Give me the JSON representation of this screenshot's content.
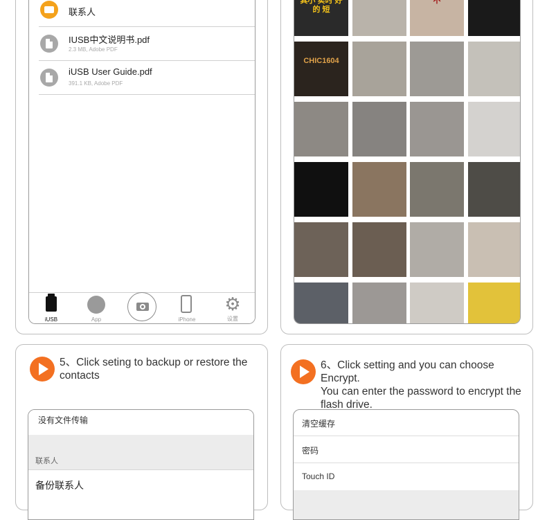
{
  "file_list": [
    {
      "name": "联系人",
      "meta": "",
      "type": "folder"
    },
    {
      "name": "IUSB中文说明书.pdf",
      "meta": "2.3 MB, Adobe PDF",
      "type": "pdf"
    },
    {
      "name": "iUSB User Guide.pdf",
      "meta": "391.1 KB, Adobe PDF",
      "type": "pdf"
    }
  ],
  "tabbar": {
    "iusb": "iUSB",
    "app": "App",
    "iphone": "iPhone",
    "settings": "设置"
  },
  "photo_grid": {
    "rows": 6,
    "cols": 4,
    "tiles": [
      {
        "bg": "#2a2a2a",
        "text": "其小 实时 好的 短",
        "color": "#f5c31a"
      },
      {
        "bg": "#b9b3aa",
        "text": "",
        "color": "#000"
      },
      {
        "bg": "#c7b4a3",
        "text": "不",
        "color": "#a01010"
      },
      {
        "bg": "#1a1a1a",
        "text": "",
        "color": "#e33"
      },
      {
        "bg": "#2b241e",
        "text": "CHIC1604",
        "color": "#e0a24a"
      },
      {
        "bg": "#a8a39a",
        "text": "",
        "color": "#000"
      },
      {
        "bg": "#9d9a95",
        "text": "",
        "color": "#000"
      },
      {
        "bg": "#c4c1ba",
        "text": "",
        "color": "#000"
      },
      {
        "bg": "#8d8984",
        "text": "",
        "color": "#000"
      },
      {
        "bg": "#868380",
        "text": "",
        "color": "#000"
      },
      {
        "bg": "#9a9692",
        "text": "",
        "color": "#000"
      },
      {
        "bg": "#d4d2cf",
        "text": "",
        "color": "#000"
      },
      {
        "bg": "#101010",
        "text": "",
        "color": "#fff"
      },
      {
        "bg": "#8a7560",
        "text": "",
        "color": "#000"
      },
      {
        "bg": "#7b776e",
        "text": "",
        "color": "#000"
      },
      {
        "bg": "#4e4c47",
        "text": "",
        "color": "#000"
      },
      {
        "bg": "#6d6258",
        "text": "",
        "color": "#000"
      },
      {
        "bg": "#6b5e52",
        "text": "",
        "color": "#000"
      },
      {
        "bg": "#b0aca6",
        "text": "",
        "color": "#000"
      },
      {
        "bg": "#c9bfb3",
        "text": "",
        "color": "#000"
      },
      {
        "bg": "#5c6067",
        "text": "",
        "color": "#000"
      },
      {
        "bg": "#9c9895",
        "text": "",
        "color": "#000"
      },
      {
        "bg": "#cfcbc5",
        "text": "",
        "color": "#000"
      },
      {
        "bg": "#e2c23a",
        "text": "",
        "color": "#000"
      }
    ]
  },
  "step5": {
    "text_line1": "5、Click seting to backup or restore the",
    "text_line2": "contacts"
  },
  "step6": {
    "text_line1": "6、Click setting and you can choose Encrypt.",
    "text_line2": "You can enter the password to encrypt the",
    "text_line3": "flash drive."
  },
  "backup_screen": {
    "top_row": "没有文件传输",
    "section_header": "联系人",
    "backup_row": "备份联系人"
  },
  "settings_screen": {
    "clear_cache": "清空缓存",
    "password": "密码",
    "touch_id": "Touch ID"
  },
  "colors": {
    "accent_orange": "#f37021",
    "folder_orange": "#f4a21c",
    "border": "#bdbdbd"
  }
}
